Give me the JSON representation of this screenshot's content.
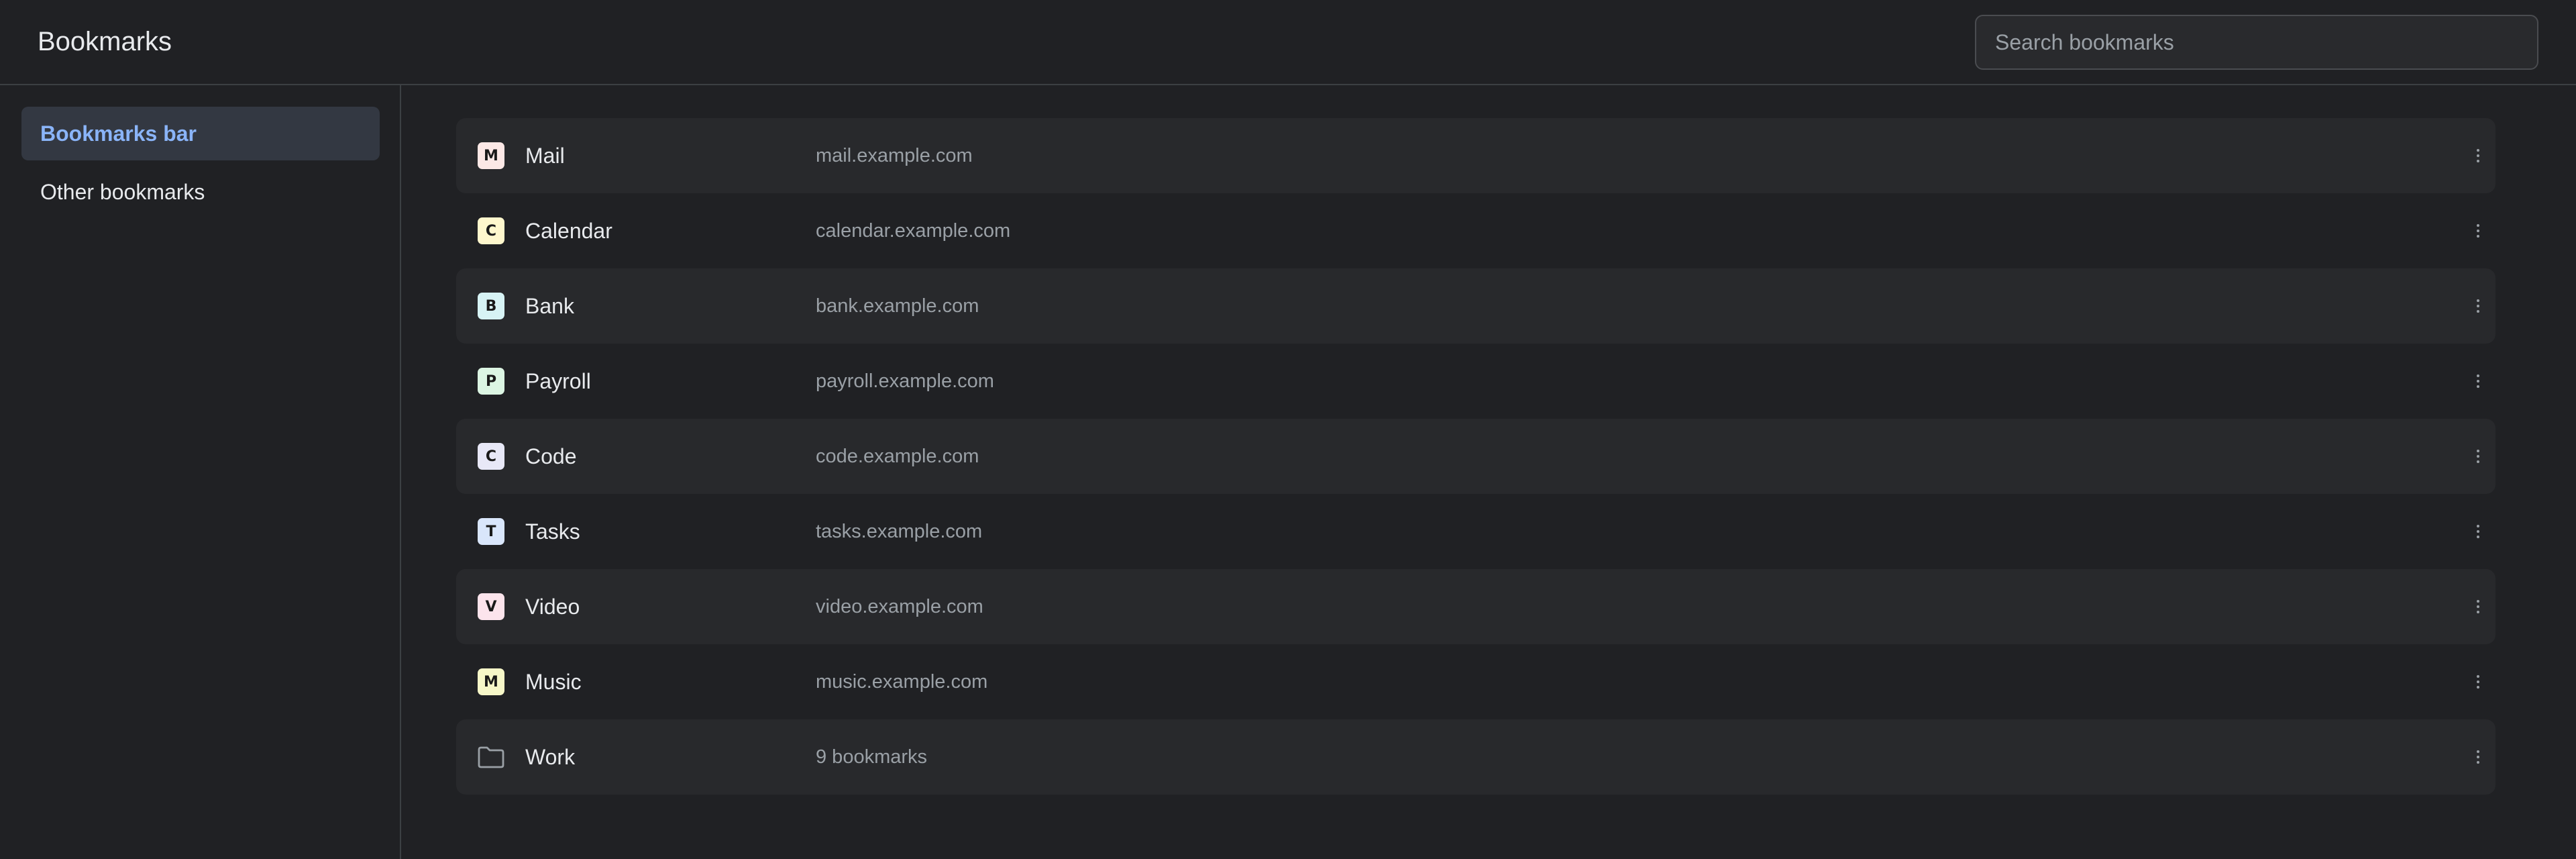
{
  "header": {
    "title": "Bookmarks",
    "search_placeholder": "Search bookmarks"
  },
  "sidebar": {
    "items": [
      {
        "label": "Bookmarks bar",
        "active": true
      },
      {
        "label": "Other bookmarks",
        "active": false
      }
    ]
  },
  "bookmarks": [
    {
      "type": "link",
      "letter": "M",
      "name": "Mail",
      "url": "mail.example.com",
      "favicon_color": "#fce8e6"
    },
    {
      "type": "link",
      "letter": "C",
      "name": "Calendar",
      "url": "calendar.example.com",
      "favicon_color": "#fef7cd"
    },
    {
      "type": "link",
      "letter": "B",
      "name": "Bank",
      "url": "bank.example.com",
      "favicon_color": "#d7f3f5"
    },
    {
      "type": "link",
      "letter": "P",
      "name": "Payroll",
      "url": "payroll.example.com",
      "favicon_color": "#dcf5e3"
    },
    {
      "type": "link",
      "letter": "C",
      "name": "Code",
      "url": "code.example.com",
      "favicon_color": "#e8e8f7"
    },
    {
      "type": "link",
      "letter": "T",
      "name": "Tasks",
      "url": "tasks.example.com",
      "favicon_color": "#d9e6fb"
    },
    {
      "type": "link",
      "letter": "V",
      "name": "Video",
      "url": "video.example.com",
      "favicon_color": "#fce4ec"
    },
    {
      "type": "link",
      "letter": "M",
      "name": "Music",
      "url": "music.example.com",
      "favicon_color": "#f6f7c8"
    },
    {
      "type": "folder",
      "icon": "folder-icon",
      "name": "Work",
      "url": "9 bookmarks"
    }
  ],
  "icons": {
    "more": "more-vertical-icon",
    "folder": "folder-icon"
  }
}
